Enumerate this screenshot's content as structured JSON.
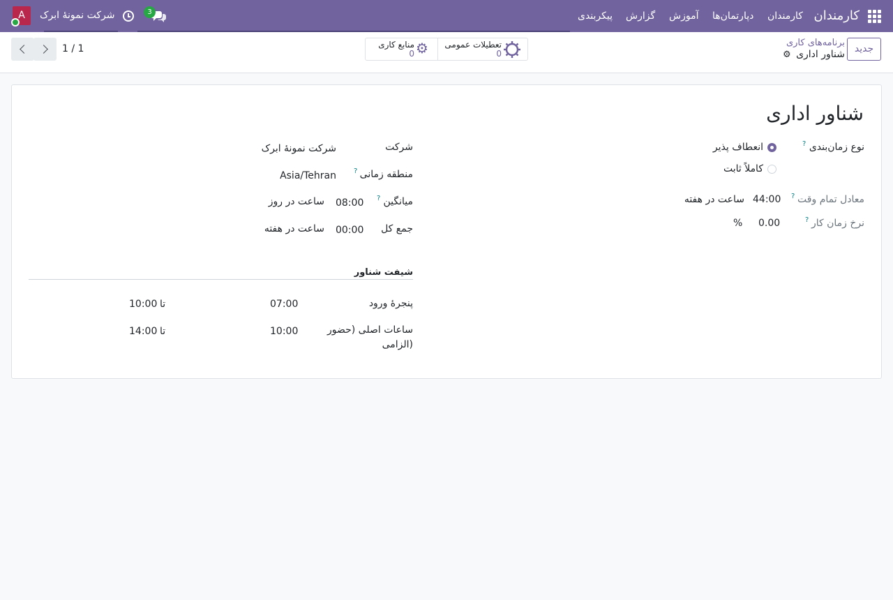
{
  "navbar": {
    "brand": "کارمندان",
    "menu": [
      "کارمندان",
      "دپارتمان‌ها",
      "آموزش",
      "گزارش",
      "پیکربندی"
    ],
    "chat_badge": "3",
    "company": "شرکت نمونهٔ ابرک",
    "avatar_letter": "A",
    "icons": [
      "apps-grid-icon",
      "chat-icon",
      "clock-icon"
    ],
    "colors": {
      "navbar": "#71639e",
      "badge": "#28a745",
      "avatar": "#b9274d"
    }
  },
  "control_panel": {
    "new_button": "جدید",
    "breadcrumb_parent": "برنامه‌های کاری",
    "breadcrumb_current": "شناور اداری",
    "smart_buttons": [
      {
        "title": "تعطیلات عمومی",
        "value": "0",
        "icon": "sun-icon"
      },
      {
        "title": "منابع کاری",
        "value": "0",
        "icon": "cogs-icon"
      }
    ],
    "pager": "1 / 1"
  },
  "form": {
    "title": "شناور اداری",
    "schedule_type": {
      "label": "نوع زمان‌بندی",
      "options": [
        "انعطاف پذیر",
        "کاملاً ثابت"
      ],
      "selected": "انعطاف پذیر"
    },
    "full_time_equiv": {
      "label": "معادل تمام وقت",
      "value": "44:00",
      "unit": "ساعت در هفته"
    },
    "work_time_rate": {
      "label": "نرخ زمان کار",
      "value": "0.00",
      "unit": "%"
    },
    "company": {
      "label": "شرکت",
      "value": "شرکت نمونهٔ ابرک"
    },
    "timezone": {
      "label": "منطقه زمانی",
      "value": "Asia/Tehran"
    },
    "average": {
      "label": "میانگین",
      "value": "08:00",
      "unit": "ساعت در روز"
    },
    "total": {
      "label": "جمع کل",
      "value": "00:00",
      "unit": "ساعت در هفته"
    },
    "flex_shift": {
      "title": "شیفت شناور",
      "rows": [
        {
          "label": "پنجرهٔ ورود",
          "from": "07:00",
          "to_label": "تا",
          "to": "10:00"
        },
        {
          "label_line1": "ساعات اصلی (حضور",
          "label_line2": "الزامی)",
          "from": "10:00",
          "to_label": "تا",
          "to": "14:00"
        }
      ]
    },
    "help_mark": "?"
  }
}
